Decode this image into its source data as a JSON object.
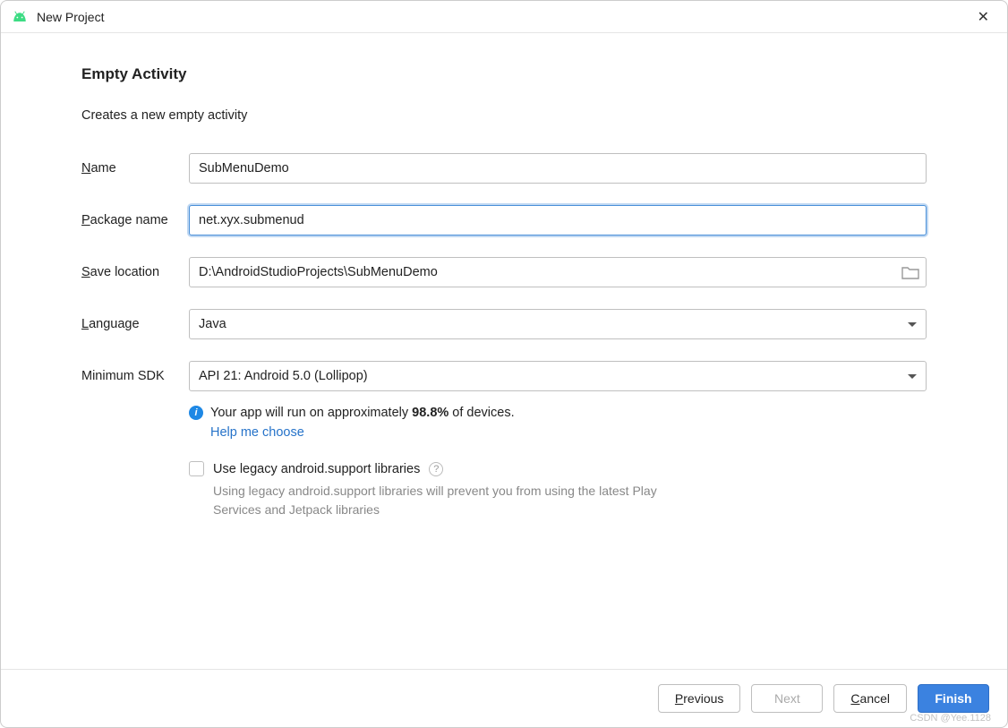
{
  "window": {
    "title": "New Project"
  },
  "header": {
    "title": "Empty Activity",
    "description": "Creates a new empty activity"
  },
  "form": {
    "name": {
      "label": "Name",
      "value": "SubMenuDemo"
    },
    "package": {
      "label": "Package name",
      "value": "net.xyx.submenud"
    },
    "location": {
      "label": "Save location",
      "value": "D:\\AndroidStudioProjects\\SubMenuDemo"
    },
    "language": {
      "label": "Language",
      "value": "Java"
    },
    "minsdk": {
      "label": "Minimum SDK",
      "value": "API 21: Android 5.0 (Lollipop)"
    }
  },
  "info": {
    "prefix": "Your app will run on approximately ",
    "percent": "98.8%",
    "suffix": " of devices.",
    "help_link": "Help me choose"
  },
  "legacy": {
    "label": "Use legacy android.support libraries",
    "hint": "Using legacy android.support libraries will prevent you from using the latest Play Services and Jetpack libraries"
  },
  "buttons": {
    "previous": "Previous",
    "next": "Next",
    "cancel": "Cancel",
    "finish": "Finish"
  },
  "watermark": "CSDN @Yee.1128"
}
